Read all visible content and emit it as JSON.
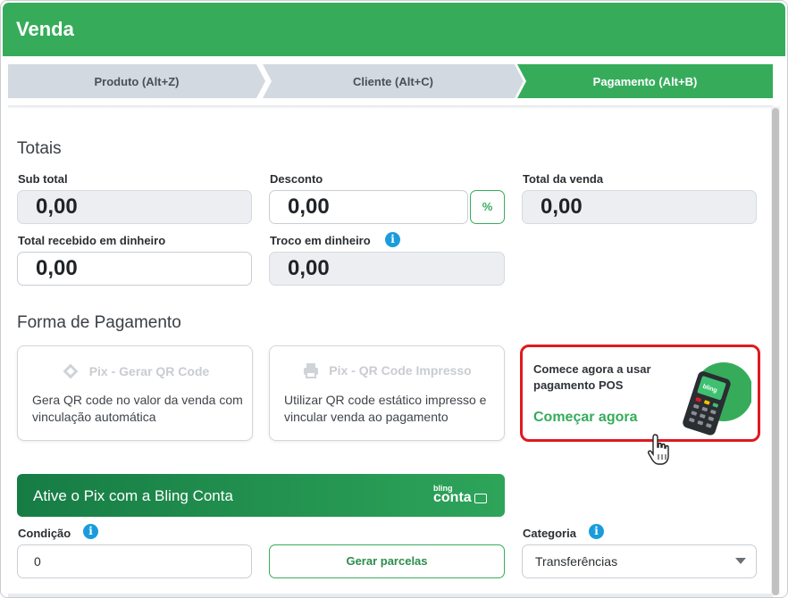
{
  "header": {
    "title": "Venda"
  },
  "steps": [
    {
      "label": "Produto (Alt+Z)",
      "active": false
    },
    {
      "label": "Cliente (Alt+C)",
      "active": false
    },
    {
      "label": "Pagamento (Alt+B)",
      "active": true
    }
  ],
  "totais": {
    "title": "Totais",
    "subtotal": {
      "label": "Sub total",
      "value": "0,00"
    },
    "desconto": {
      "label": "Desconto",
      "value": "0,00",
      "toggle": "%"
    },
    "total_venda": {
      "label": "Total da venda",
      "value": "0,00"
    },
    "recebido": {
      "label": "Total recebido em dinheiro",
      "value": "0,00"
    },
    "troco": {
      "label": "Troco em dinheiro",
      "value": "0,00",
      "info": "i"
    }
  },
  "pagamento": {
    "title": "Forma de Pagamento",
    "cards": [
      {
        "title": "Pix - Gerar QR Code",
        "description": "Gera QR code no valor da venda com vinculação automática",
        "icon": "pix-icon"
      },
      {
        "title": "Pix - QR Code Impresso",
        "description": "Utilizar QR code estático impresso e vincular venda ao pagamento",
        "icon": "printer-icon"
      }
    ],
    "pos": {
      "text": "Comece agora a usar pagamento POS",
      "link": "Começar agora",
      "device_label": "bling"
    }
  },
  "banner": {
    "text": "Ative o Pix com a Bling Conta",
    "logo_top": "bling",
    "logo": "conta"
  },
  "condicao": {
    "label": "Condição",
    "value": "0",
    "info": "i"
  },
  "gerar_parcelas": {
    "label": "Gerar parcelas"
  },
  "categoria": {
    "label": "Categoria",
    "value": "Transferências",
    "info": "i"
  },
  "colors": {
    "brand_green": "#36ac5b",
    "highlight_red": "#e0191f",
    "info_blue": "#1a9cdc"
  }
}
